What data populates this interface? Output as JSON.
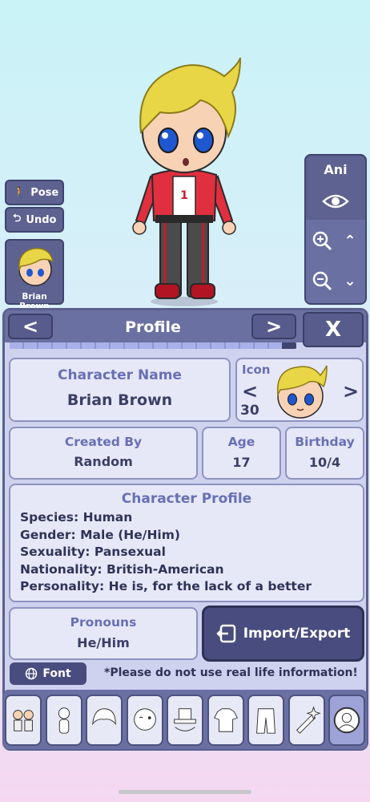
{
  "side": {
    "pose_label": "Pose",
    "undo_label": "Undo"
  },
  "preset": {
    "name": "Brian Brown"
  },
  "ani": {
    "label": "Ani"
  },
  "header": {
    "title": "Profile",
    "prev_symbol": "<",
    "next_symbol": ">",
    "close_symbol": "X",
    "progress": 0.95
  },
  "name_card": {
    "label": "Character Name",
    "value": "Brian Brown"
  },
  "icon_card": {
    "label": "Icon",
    "number": "30",
    "prev_symbol": "<",
    "next_symbol": ">"
  },
  "created_card": {
    "label": "Created By",
    "value": "Random"
  },
  "age_card": {
    "label": "Age",
    "value": "17"
  },
  "birthday_card": {
    "label": "Birthday",
    "value": "10/4"
  },
  "profile_card": {
    "label": "Character Profile",
    "lines": [
      "Species: Human",
      "Gender: Male (He/Him)",
      "Sexuality: Pansexual",
      "Nationality: British-American",
      "Personality: He is, for the lack of a better"
    ]
  },
  "pronouns_card": {
    "label": "Pronouns",
    "value": "He/Him"
  },
  "import_export": {
    "label": "Import/Export"
  },
  "font_button": {
    "label": "Font"
  },
  "notice": {
    "text": "*Please do not use real life information!"
  },
  "category_tabs": [
    "presets-icon",
    "body-icon",
    "hair-icon",
    "face-icon",
    "hat-icon",
    "top-icon",
    "bottom-icon",
    "props-icon",
    "profile-icon"
  ],
  "colors": {
    "panel": "#cfd2ee",
    "header": "#6b70a3",
    "accent": "#484c7e",
    "label": "#6870b3"
  }
}
